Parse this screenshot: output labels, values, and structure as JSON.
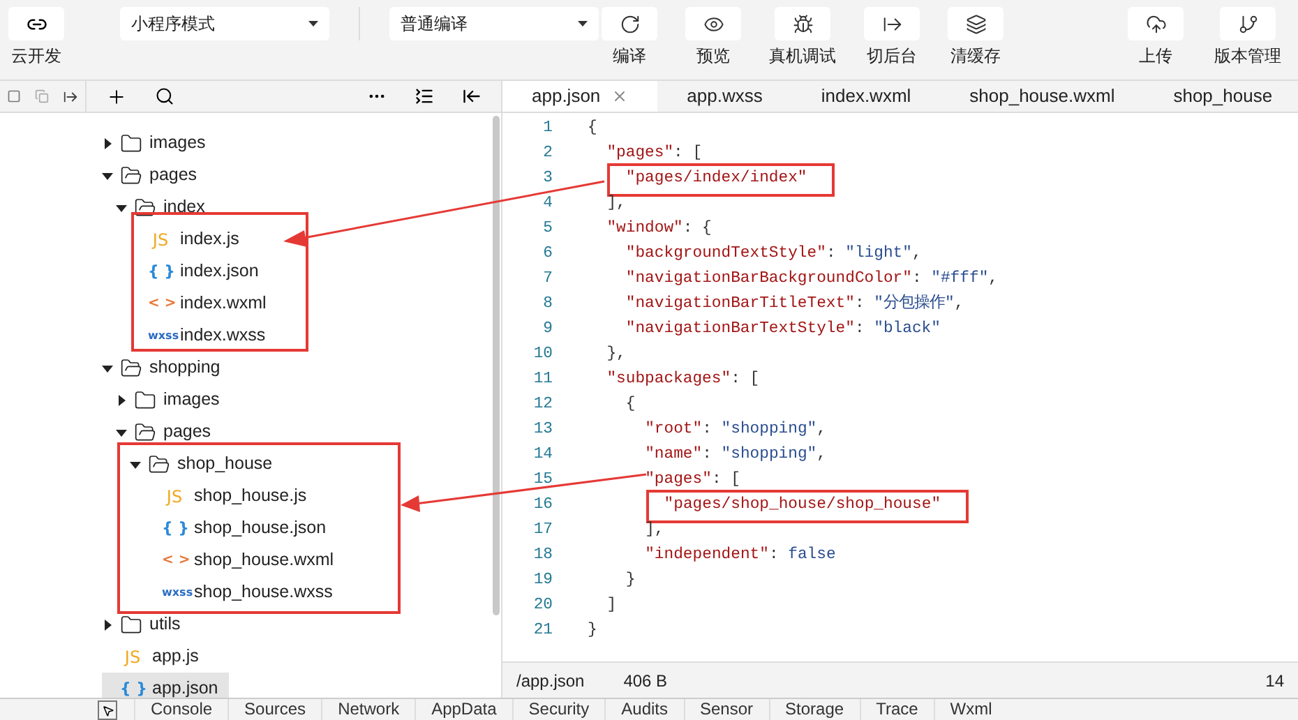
{
  "toolbar": {
    "cloud": {
      "label": "云开发"
    },
    "mode_select": {
      "value": "小程序模式"
    },
    "compile_select": {
      "value": "普通编译"
    },
    "actions": [
      {
        "kind": "refresh",
        "label": "编译"
      },
      {
        "kind": "eye",
        "label": "预览"
      },
      {
        "kind": "bug",
        "label": "真机调试"
      },
      {
        "kind": "switch",
        "label": "切后台"
      },
      {
        "kind": "layers",
        "label": "清缓存"
      }
    ],
    "right_actions": [
      {
        "kind": "upload",
        "label": "上传"
      },
      {
        "kind": "branch",
        "label": "版本管理"
      }
    ]
  },
  "editor_tabs": [
    {
      "label": "app.json",
      "selected": true
    },
    {
      "label": "app.wxss",
      "selected": false
    },
    {
      "label": "index.wxml",
      "selected": false
    },
    {
      "label": "shop_house.wxml",
      "selected": false
    },
    {
      "label": "shop_house",
      "selected": false
    }
  ],
  "file_tree": [
    {
      "name": "images",
      "kind": "folder",
      "expanded": false,
      "selected": false
    },
    {
      "name": "pages",
      "kind": "folder",
      "expanded": true,
      "selected": false,
      "children": [
        {
          "name": "index",
          "kind": "folder",
          "expanded": true,
          "selected": false,
          "children": [
            {
              "name": "index.js",
              "kind": "js",
              "badge": "JS",
              "selected": false
            },
            {
              "name": "index.json",
              "kind": "json",
              "badge": "{ }",
              "selected": false
            },
            {
              "name": "index.wxml",
              "kind": "wxml",
              "badge": "< >",
              "selected": false
            },
            {
              "name": "index.wxss",
              "kind": "wxss",
              "badge": "wxss",
              "selected": false
            }
          ]
        }
      ]
    },
    {
      "name": "shopping",
      "kind": "folder",
      "expanded": true,
      "selected": false,
      "children": [
        {
          "name": "images",
          "kind": "folder",
          "expanded": false,
          "selected": false
        },
        {
          "name": "pages",
          "kind": "folder",
          "expanded": true,
          "selected": false,
          "children": [
            {
              "name": "shop_house",
              "kind": "folder",
              "expanded": true,
              "selected": false,
              "children": [
                {
                  "name": "shop_house.js",
                  "kind": "js",
                  "badge": "JS",
                  "selected": false
                },
                {
                  "name": "shop_house.json",
                  "kind": "json",
                  "badge": "{ }",
                  "selected": false
                },
                {
                  "name": "shop_house.wxml",
                  "kind": "wxml",
                  "badge": "< >",
                  "selected": false
                },
                {
                  "name": "shop_house.wxss",
                  "kind": "wxss",
                  "badge": "wxss",
                  "selected": false
                }
              ]
            }
          ]
        }
      ]
    },
    {
      "name": "utils",
      "kind": "folder",
      "expanded": false,
      "selected": false
    },
    {
      "name": "app.js",
      "kind": "js",
      "badge": "JS",
      "selected": false
    },
    {
      "name": "app.json",
      "kind": "json",
      "badge": "{ }",
      "selected": true
    }
  ],
  "code_lines": [
    {
      "number": "1",
      "tokens": [
        {
          "kind": "punct",
          "text": "{"
        }
      ]
    },
    {
      "number": "2",
      "tokens": [
        {
          "kind": "key",
          "text": "\"pages\""
        },
        {
          "kind": "punct",
          "text": ": ["
        }
      ]
    },
    {
      "number": "3",
      "boxed": true,
      "tokens": [
        {
          "kind": "key",
          "text": "\"pages/index/index\""
        }
      ]
    },
    {
      "number": "4",
      "tokens": [
        {
          "kind": "punct",
          "text": "],"
        }
      ]
    },
    {
      "number": "5",
      "tokens": [
        {
          "kind": "key",
          "text": "\"window\""
        },
        {
          "kind": "punct",
          "text": ": {"
        }
      ]
    },
    {
      "number": "6",
      "tokens": [
        {
          "kind": "key",
          "text": "\"backgroundTextStyle\""
        },
        {
          "kind": "punct",
          "text": ": "
        },
        {
          "kind": "string",
          "text": "\"light\""
        },
        {
          "kind": "punct",
          "text": ","
        }
      ]
    },
    {
      "number": "7",
      "tokens": [
        {
          "kind": "key",
          "text": "\"navigationBarBackgroundColor\""
        },
        {
          "kind": "punct",
          "text": ": "
        },
        {
          "kind": "string",
          "text": "\"#fff\""
        },
        {
          "kind": "punct",
          "text": ","
        }
      ]
    },
    {
      "number": "8",
      "tokens": [
        {
          "kind": "key",
          "text": "\"navigationBarTitleText\""
        },
        {
          "kind": "punct",
          "text": ": "
        },
        {
          "kind": "string",
          "text": "\"分包操作\""
        },
        {
          "kind": "punct",
          "text": ","
        }
      ]
    },
    {
      "number": "9",
      "tokens": [
        {
          "kind": "key",
          "text": "\"navigationBarTextStyle\""
        },
        {
          "kind": "punct",
          "text": ": "
        },
        {
          "kind": "string",
          "text": "\"black\""
        }
      ]
    },
    {
      "number": "10",
      "tokens": [
        {
          "kind": "punct",
          "text": "},"
        }
      ]
    },
    {
      "number": "11",
      "tokens": [
        {
          "kind": "key",
          "text": "\"subpackages\""
        },
        {
          "kind": "punct",
          "text": ": ["
        }
      ]
    },
    {
      "number": "12",
      "tokens": [
        {
          "kind": "punct",
          "text": "{"
        }
      ]
    },
    {
      "number": "13",
      "tokens": [
        {
          "kind": "key",
          "text": "\"root\""
        },
        {
          "kind": "punct",
          "text": ": "
        },
        {
          "kind": "string",
          "text": "\"shopping\""
        },
        {
          "kind": "punct",
          "text": ","
        }
      ]
    },
    {
      "number": "14",
      "tokens": [
        {
          "kind": "key",
          "text": "\"name\""
        },
        {
          "kind": "punct",
          "text": ": "
        },
        {
          "kind": "string",
          "text": "\"shopping\""
        },
        {
          "kind": "punct",
          "text": ","
        }
      ]
    },
    {
      "number": "15",
      "tokens": [
        {
          "kind": "key",
          "text": "\"pages\""
        },
        {
          "kind": "punct",
          "text": ": ["
        }
      ]
    },
    {
      "number": "16",
      "boxed": true,
      "tokens": [
        {
          "kind": "key",
          "text": "\"pages/shop_house/shop_house\""
        }
      ]
    },
    {
      "number": "17",
      "tokens": [
        {
          "kind": "punct",
          "text": "],"
        }
      ]
    },
    {
      "number": "18",
      "tokens": [
        {
          "kind": "key",
          "text": "\"independent\""
        },
        {
          "kind": "punct",
          "text": ": "
        },
        {
          "kind": "keyword",
          "text": "false"
        }
      ]
    },
    {
      "number": "19",
      "tokens": [
        {
          "kind": "punct",
          "text": "}"
        }
      ]
    },
    {
      "number": "20",
      "tokens": [
        {
          "kind": "punct",
          "text": "]"
        }
      ]
    },
    {
      "number": "21",
      "tokens": [
        {
          "kind": "punct",
          "text": "}"
        }
      ]
    }
  ],
  "status_bar": {
    "path": "/app.json",
    "size": "406 B",
    "line": "14"
  },
  "devtools_tabs": [
    {
      "label": "Console",
      "selected": false
    },
    {
      "label": "Sources",
      "selected": false
    },
    {
      "label": "Network",
      "selected": false
    },
    {
      "label": "AppData",
      "selected": false
    },
    {
      "label": "Security",
      "selected": false
    },
    {
      "label": "Audits",
      "selected": false
    },
    {
      "label": "Sensor",
      "selected": false
    },
    {
      "label": "Storage",
      "selected": false
    },
    {
      "label": "Trace",
      "selected": false
    },
    {
      "label": "Wxml",
      "selected": false
    }
  ]
}
